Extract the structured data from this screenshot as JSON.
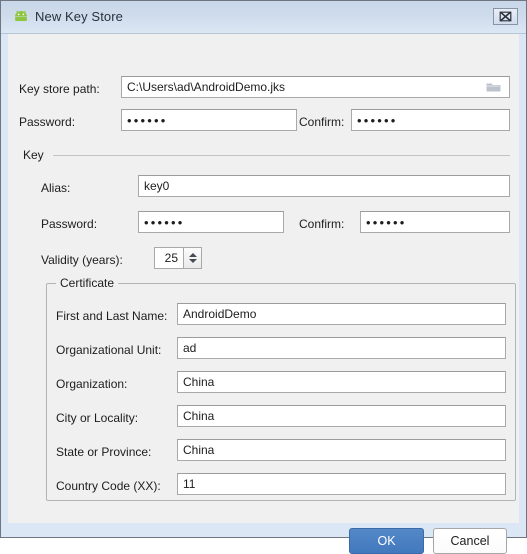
{
  "window": {
    "title": "New Key Store",
    "app_icon": "android-icon",
    "close_label": "x"
  },
  "keystore": {
    "path_label": "Key store path:",
    "path_value": "C:\\Users\\ad\\AndroidDemo.jks",
    "browse_icon": "folder-icon",
    "password_label": "Password:",
    "password_value": "••••••",
    "confirm_label": "Confirm:",
    "confirm_value": "••••••"
  },
  "key": {
    "group_label": "Key",
    "alias_label": "Alias:",
    "alias_value": "key0",
    "password_label": "Password:",
    "password_value": "••••••",
    "confirm_label": "Confirm:",
    "confirm_value": "••••••",
    "validity_label": "Validity (years):",
    "validity_value": "25"
  },
  "certificate": {
    "group_label": "Certificate",
    "fields": [
      {
        "label": "First and Last Name:",
        "value": "AndroidDemo"
      },
      {
        "label": "Organizational Unit:",
        "value": "ad"
      },
      {
        "label": "Organization:",
        "value": "China"
      },
      {
        "label": "City or Locality:",
        "value": "China"
      },
      {
        "label": "State or Province:",
        "value": "China"
      },
      {
        "label": "Country Code (XX):",
        "value": "11"
      }
    ]
  },
  "footer": {
    "ok_label": "OK",
    "cancel_label": "Cancel"
  },
  "colors": {
    "accent": "#4279bd",
    "titlebar": "#cedbeb",
    "panel": "#f0f0f0",
    "frame": "#dce7f5",
    "android_green": "#a4c639"
  }
}
